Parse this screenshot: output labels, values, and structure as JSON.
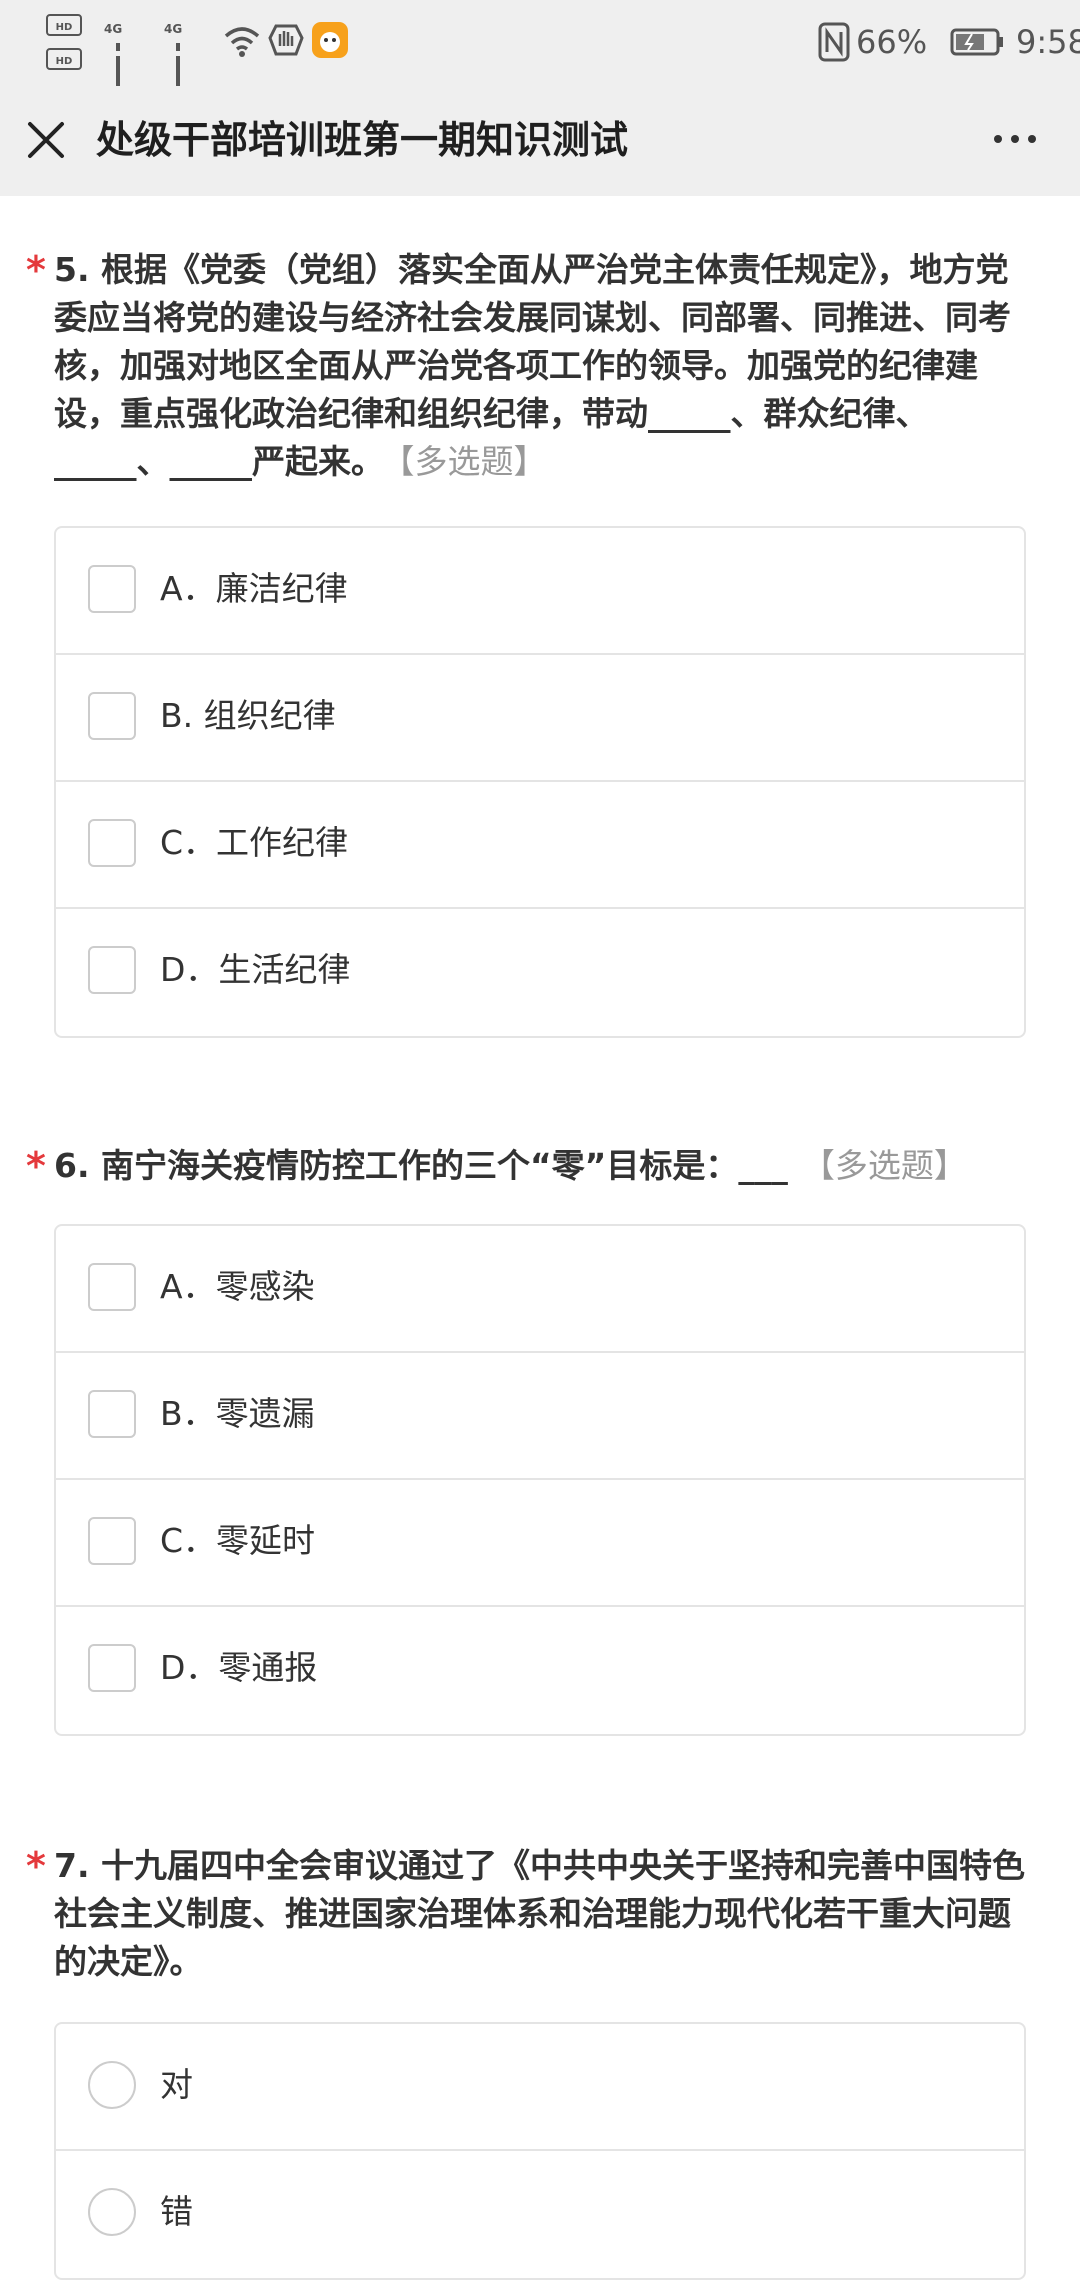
{
  "status_bar": {
    "hd1": "HD",
    "hd1_sub": "1",
    "hd2": "HD",
    "hd2_sub": "2",
    "net1": "4G",
    "net2": "4G",
    "battery_percent": "66%",
    "time": "9:58"
  },
  "header": {
    "title": "处级干部培训班第一期知识测试"
  },
  "questions": [
    {
      "required": "*",
      "text": "5. 根据《党委（党组）落实全面从严治党主体责任规定》，地方党委应当将党的建设与经济社会发展同谋划、同部署、同推进、同考核，加强对地区全面从严治党各项工作的领导。加强党的纪律建设，重点强化政治纪律和组织纪律，带动_____、群众纪律、_____、_____严起来。",
      "type": "【多选题】",
      "options": [
        "A．廉洁纪律",
        "B. 组织纪律",
        "C．工作纪律",
        "D．生活纪律"
      ]
    },
    {
      "required": "*",
      "text": "6. 南宁海关疫情防控工作的三个“零”目标是：___",
      "type": "【多选题】",
      "options": [
        "A．零感染",
        "B．零遗漏",
        "C．零延时",
        "D．零通报"
      ]
    },
    {
      "required": "*",
      "text": "7. 十九届四中全会审议通过了《中共中央关于坚持和完善中国特色社会主义制度、推进国家治理体系和治理能力现代化若干重大问题的决定》。",
      "type": "",
      "options": [
        "对",
        "错"
      ]
    }
  ]
}
